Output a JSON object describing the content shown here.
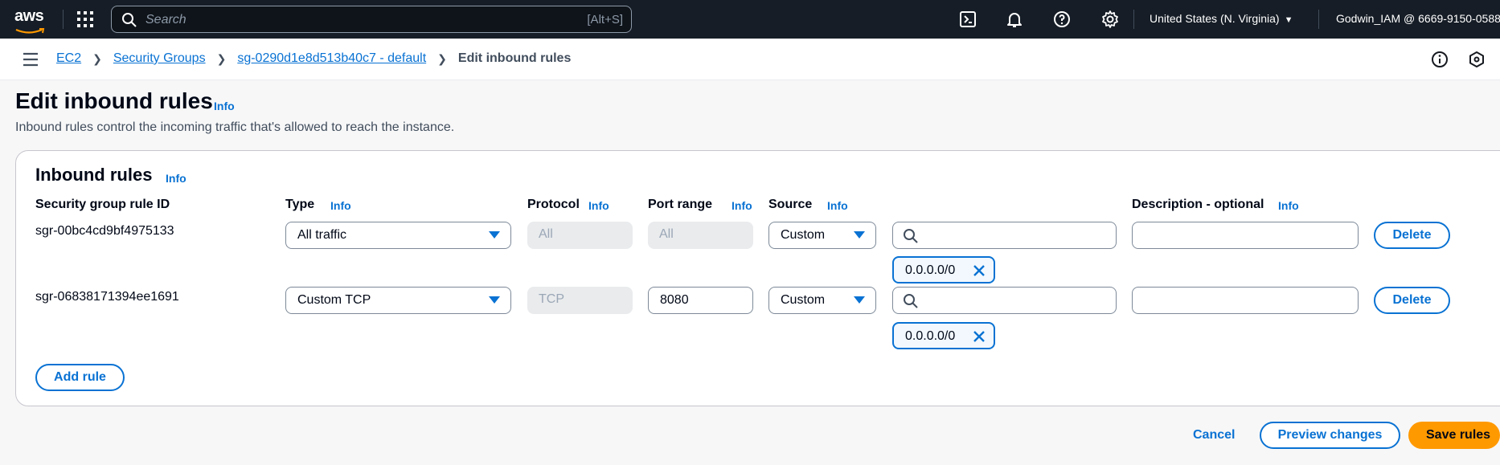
{
  "topnav": {
    "logo": "aws",
    "search_placeholder": "Search",
    "search_shortcut": "[Alt+S]",
    "region": "United States (N. Virginia)",
    "account": "Godwin_IAM @ 6669-9150-0588",
    "icons": [
      "cloudshell-icon",
      "bell-icon",
      "help-icon",
      "settings-icon"
    ]
  },
  "breadcrumb": {
    "items": [
      "EC2",
      "Security Groups",
      "sg-0290d1e8d513b40c7 - default"
    ],
    "current": "Edit inbound rules"
  },
  "page": {
    "title": "Edit inbound rules",
    "info": "Info",
    "description": "Inbound rules control the incoming traffic that's allowed to reach the instance."
  },
  "panel": {
    "title": "Inbound rules",
    "info": "Info",
    "columns": {
      "rule_id": "Security group rule ID",
      "type": "Type",
      "protocol": "Protocol",
      "port_range": "Port range",
      "source": "Source",
      "description": "Description - optional",
      "info": "Info"
    },
    "rules": [
      {
        "id": "sgr-00bc4cd9bf4975133",
        "type": "All traffic",
        "protocol": "All",
        "port_range": "All",
        "source_type": "Custom",
        "source_search": "",
        "token": "0.0.0.0/0",
        "description": "",
        "delete": "Delete"
      },
      {
        "id": "sgr-06838171394ee1691",
        "type": "Custom TCP",
        "protocol": "TCP",
        "port_range": "8080",
        "source_type": "Custom",
        "source_search": "",
        "token": "0.0.0.0/0",
        "description": "",
        "delete": "Delete"
      }
    ],
    "add_rule": "Add rule"
  },
  "footer": {
    "cancel": "Cancel",
    "preview": "Preview changes",
    "save": "Save rules"
  },
  "colors": {
    "nav_bg": "#161d26",
    "link": "#0972d3",
    "primary": "#ff9900"
  }
}
